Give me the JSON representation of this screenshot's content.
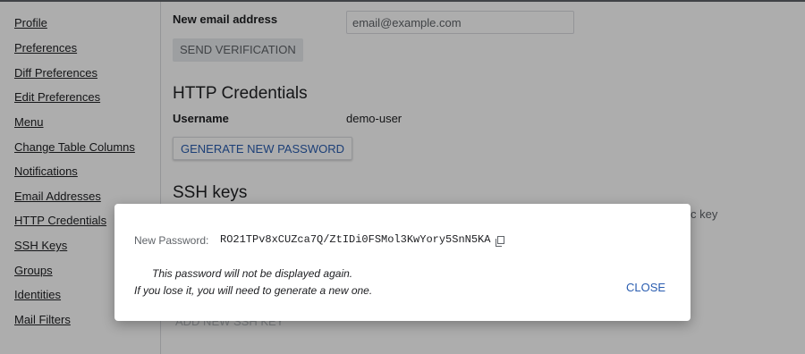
{
  "sidebar": {
    "items": [
      {
        "label": "Profile"
      },
      {
        "label": "Preferences"
      },
      {
        "label": "Diff Preferences"
      },
      {
        "label": "Edit Preferences"
      },
      {
        "label": "Menu"
      },
      {
        "label": "Change Table Columns"
      },
      {
        "label": "Notifications"
      },
      {
        "label": "Email Addresses"
      },
      {
        "label": "HTTP Credentials"
      },
      {
        "label": "SSH Keys"
      },
      {
        "label": "Groups"
      },
      {
        "label": "Identities"
      },
      {
        "label": "Mail Filters"
      }
    ]
  },
  "email": {
    "new_label": "New email address",
    "placeholder": "email@example.com",
    "send_button": "SEND VERIFICATION"
  },
  "http": {
    "title": "HTTP Credentials",
    "username_label": "Username",
    "username_value": "demo-user",
    "generate_button": "GENERATE NEW PASSWORD"
  },
  "ssh": {
    "title": "SSH keys",
    "partial_text": "c key",
    "add_button_partial": "ADD NEW SSH KEY"
  },
  "dialog": {
    "password_label": "New Password:",
    "password_value": "RO21TPv8xCUZca7Q/ZtIDi0FSMol3KwYory5SnN5KA",
    "warning_line1": "This password will not be displayed again.",
    "warning_line2": "If you lose it, you will need to generate a new one.",
    "close_button": "CLOSE"
  }
}
